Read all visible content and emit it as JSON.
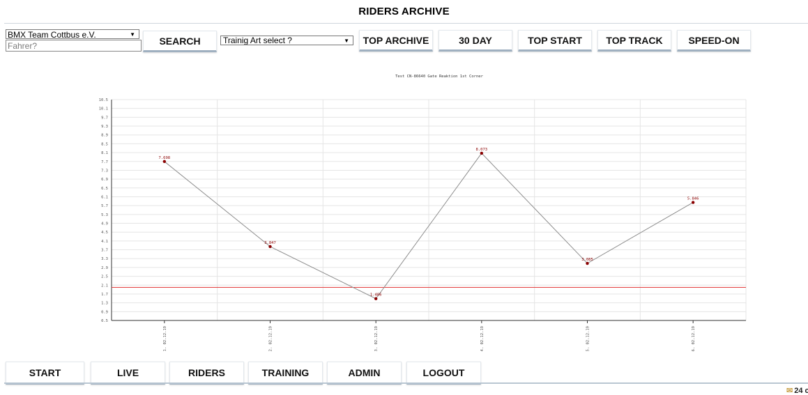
{
  "page": {
    "title": "RIDERS ARCHIVE"
  },
  "filters": {
    "team_select_value": "BMX Team Cottbus e.V.",
    "rider_placeholder": "Fahrer?",
    "search_label": "SEARCH",
    "training_select_value": "Trainig Art select ?"
  },
  "top_nav": [
    {
      "label": "TOP ARCHIVE"
    },
    {
      "label": "30 DAY"
    },
    {
      "label": "TOP START"
    },
    {
      "label": "TOP TRACK"
    },
    {
      "label": "SPEED-ON"
    }
  ],
  "bottom_nav": [
    {
      "label": "START"
    },
    {
      "label": "LIVE"
    },
    {
      "label": "RIDERS"
    },
    {
      "label": "TRAINING"
    },
    {
      "label": "ADMIN"
    },
    {
      "label": "LOGOUT"
    }
  ],
  "corner_badge": {
    "text": "24 c",
    "icon": "envelope-icon"
  },
  "colors": {
    "line": "#8c8c8c",
    "point": "#8b0000",
    "label": "#8b0000",
    "reference": "#e23a3a",
    "grid": "#e5e5e5"
  },
  "chart_data": {
    "type": "line",
    "title": "Test CN-86640 Gate Reaktion 1st Corner",
    "categories": [
      "1. 02.12.19",
      "2. 02.12.19",
      "3. 02.12.19",
      "4. 02.12.19",
      "5. 02.12.19",
      "6. 02.12.19"
    ],
    "series": [
      {
        "values": [
          7.698,
          3.847,
          1.486,
          8.073,
          3.085,
          5.846
        ],
        "data_labels": [
          "7.698",
          "3.847",
          "1.486",
          "8.073",
          "3.085",
          "5.846"
        ]
      }
    ],
    "y_ticks": [
      "10.5",
      "10.1",
      "9.7",
      "9.3",
      "8.9",
      "8.5",
      "8.1",
      "7.7",
      "7.3",
      "6.9",
      "6.5",
      "6.1",
      "5.7",
      "5.3",
      "4.9",
      "4.5",
      "4.1",
      "3.7",
      "3.3",
      "2.9",
      "2.5",
      "2.1",
      "1.7",
      "1.3",
      "0.9",
      "0.5"
    ],
    "ylim": [
      0.5,
      10.5
    ],
    "reference_line": 2.0,
    "grid": true,
    "xlabel": "",
    "ylabel": ""
  }
}
